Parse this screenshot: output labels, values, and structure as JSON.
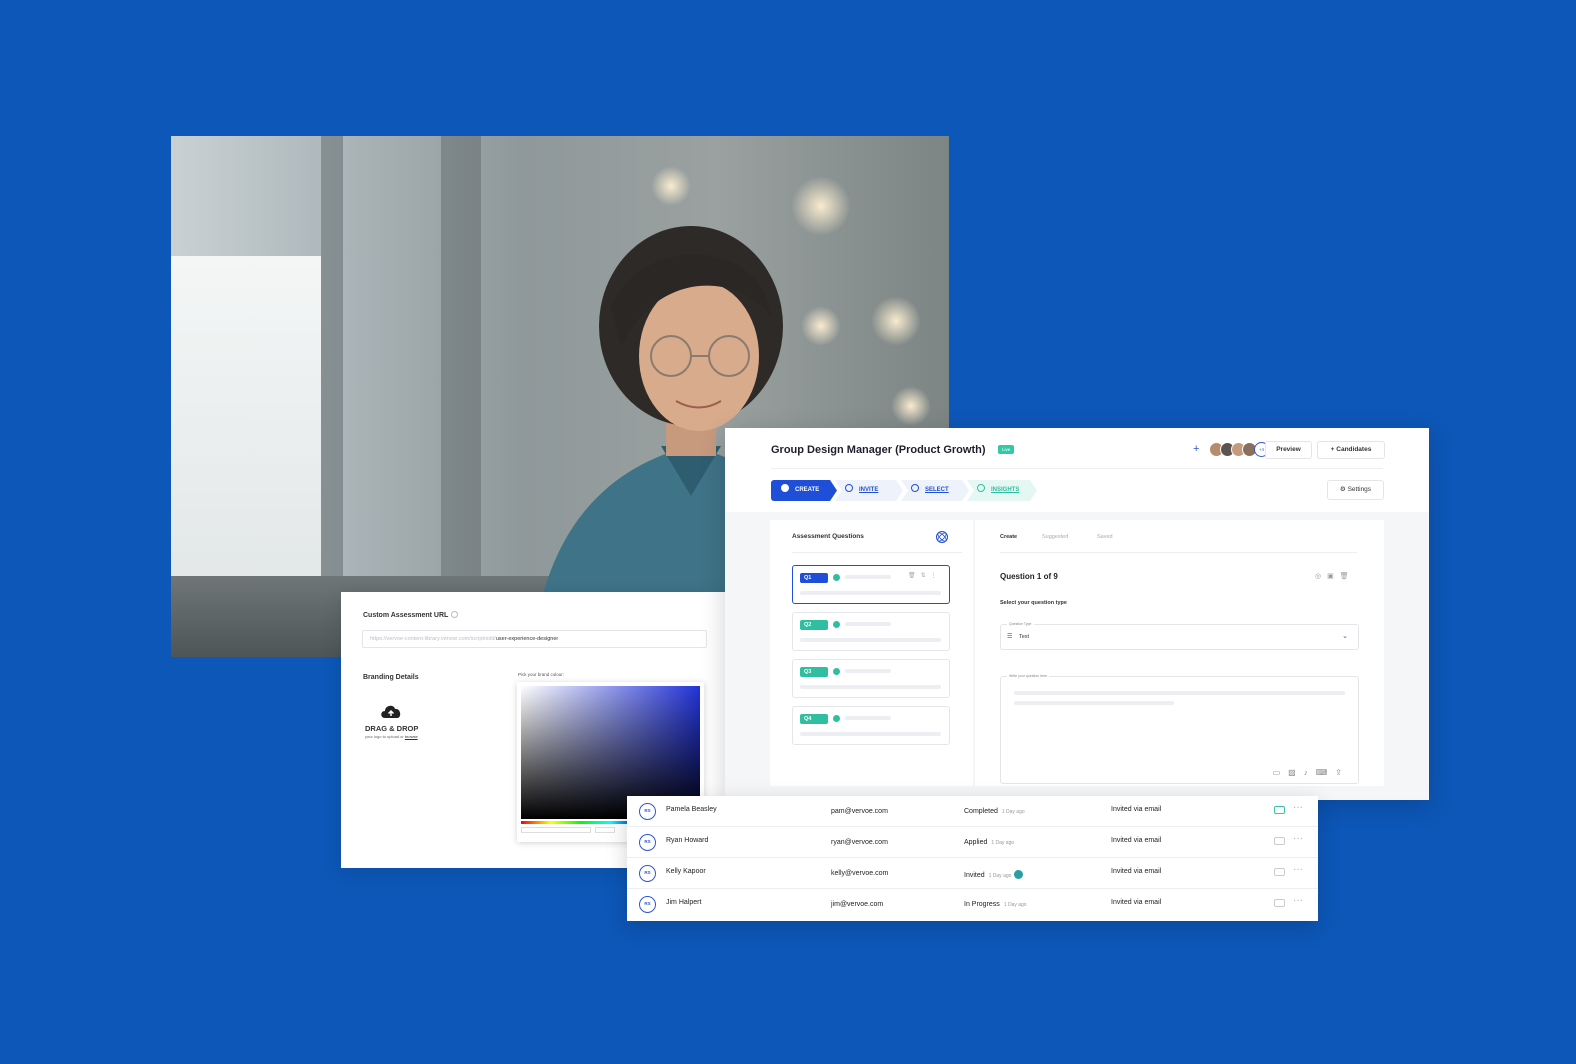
{
  "assessment": {
    "title": "Group Design Manager (Product Growth)",
    "status_badge": "Live",
    "collaborators_more": "+4",
    "preview_label": "Preview",
    "candidates_label": "Candidates",
    "settings_label": "Settings",
    "steps": [
      {
        "label": "CREATE",
        "state": "active"
      },
      {
        "label": "INVITE",
        "state": "todo"
      },
      {
        "label": "SELECT",
        "state": "todo"
      },
      {
        "label": "INSIGHTS",
        "state": "todo"
      }
    ]
  },
  "questions_panel": {
    "heading": "Assessment Questions",
    "questions": [
      {
        "tag": "Q1",
        "active": true
      },
      {
        "tag": "Q2",
        "active": false
      },
      {
        "tag": "Q3",
        "active": false
      },
      {
        "tag": "Q4",
        "active": false
      }
    ]
  },
  "editor": {
    "tabs": [
      "Create",
      "Suggested",
      "Saved"
    ],
    "active_tab": "Create",
    "question_counter": "Question 1 of 9",
    "select_type_label": "Select your question type",
    "type_field_label": "Question Type",
    "type_value": "Text",
    "question_field_label": "Write your question here"
  },
  "branding": {
    "url_label": "Custom Assessment URL",
    "url_prefix": "https://vervoe-content-library.vervoe.com/script/edit/",
    "url_slug": "user-experience-designer",
    "branding_label": "Branding Details",
    "drop_title": "DRAG & DROP",
    "drop_sub": "your logo to upload or",
    "drop_link": "browse",
    "pick_label": "Pick your brand colour:"
  },
  "candidates": [
    {
      "initials": "RS",
      "name": "Pamela Beasley",
      "email": "pam@vervoe.com",
      "status": "Completed",
      "when": "1 Day ago",
      "invite": "Invited via email",
      "verified": false,
      "mail_sent": true
    },
    {
      "initials": "RS",
      "name": "Ryan Howard",
      "email": "ryan@vervoe.com",
      "status": "Applied",
      "when": "1 Day ago",
      "invite": "Invited via email",
      "verified": false,
      "mail_sent": false
    },
    {
      "initials": "RS",
      "name": "Kelly Kapoor",
      "email": "kelly@vervoe.com",
      "status": "Invited",
      "when": "1 Day ago",
      "invite": "Invited via email",
      "verified": true,
      "mail_sent": false
    },
    {
      "initials": "RS",
      "name": "Jim Halpert",
      "email": "jim@vervoe.com",
      "status": "In Progress",
      "when": "1 Day ago",
      "invite": "Invited via email",
      "verified": false,
      "mail_sent": false
    }
  ],
  "colors": {
    "background": "#0d57b8",
    "primary": "#1f4fd8",
    "teal": "#2fbfa0",
    "live_badge": "#33c8a8"
  }
}
